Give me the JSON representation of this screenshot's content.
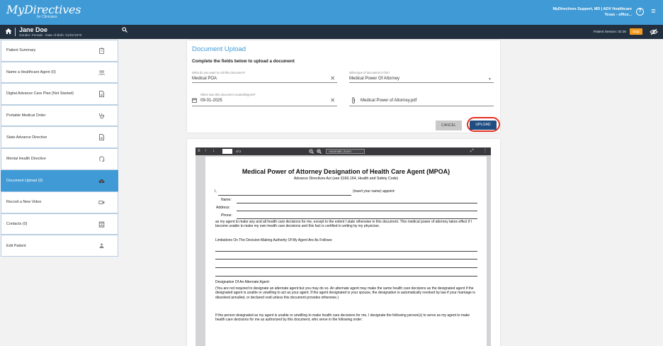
{
  "header": {
    "logo_text": "MyDirectives",
    "logo_sub": "for Clinicians",
    "account_line1": "MyDirectives Support, MD | ADV Healthcare",
    "account_line2": "Texas - office...",
    "brand_color": "#3f9ad6",
    "icons": [
      "help-icon",
      "menu-icon"
    ]
  },
  "patient": {
    "name": "Jane Doe",
    "info": "Gender: Female · Date of Birth: 01/01/1970",
    "session": "Patient Session: 02:35",
    "stop_label": "Stop"
  },
  "sidebar": {
    "items": [
      {
        "label": "Patient Summary",
        "icon": "clipboard-icon"
      },
      {
        "label": "Name a Healthcare Agent (0)",
        "icon": "people-icon"
      },
      {
        "label": "Digital Advance Care Plan (Not Started)",
        "icon": "document-icon"
      },
      {
        "label": "Portable Medical Order",
        "icon": "stethoscope-icon"
      },
      {
        "label": "State Advance Directive",
        "icon": "document-icon"
      },
      {
        "label": "Mental Health Directive",
        "icon": "head-icon"
      },
      {
        "label": "Document Upload (0)",
        "icon": "cloud-upload-icon",
        "active": true
      },
      {
        "label": "Record a New Video",
        "icon": "video-icon"
      },
      {
        "label": "Contacts (0)",
        "icon": "contacts-icon"
      },
      {
        "label": "Edit Patient",
        "icon": "person-icon"
      }
    ]
  },
  "upload": {
    "title": "Document Upload",
    "subtitle": "Complete the fields below to upload a document",
    "name_label": "What do you want to call this document?",
    "name_value": "Medical POA",
    "type_label": "What type of document is this?",
    "type_value": "Medical Power Of Attorney",
    "date_label": "When was this document created/signed?",
    "date_value": "09-01-2025",
    "file_value": "Medical Power of Attorney.pdf",
    "cancel_label": "CANCEL",
    "upload_label": "UPLOAD",
    "highlight_color": "#e2301e"
  },
  "viewer": {
    "zoom_label": "Automatic Zoom",
    "page_of": "of 2",
    "title": "Medical Power of Attorney Designation of Health Care Agent (MPOA)",
    "subtitle": "Advance Directives Act (see §166.164, Health and Safety Code)",
    "line_i": "I,",
    "insert_name": "(insert your name) appoint:",
    "name_label": "Name:",
    "address_label": "Address:",
    "phone_label": "Phone:",
    "para1": "as my agent to make any and all health care decisions for me, except to the extent I state otherwise in this document. This medical power of attorney takes effect if I become unable to make my own health care decisions and this fact is certified in writing by my physician.",
    "limitations": "Limitations On The Decision-Making Authority Of My Agent Are As Follows:",
    "alternate": "Designation Of An Alternate Agent:",
    "para2": "(You are not required to designate an alternate agent but you may do so. An alternate agent may make the same health care decisions as the designated agent if the designated agent is unable or unwilling to act as your agent. If the agent designated is your spouse, the designation is automatically revoked by law if your marriage is dissolved annulled, or declared void unless this document provides otherwise.)",
    "para3": "If the person designated as my agent is unable or unwilling to make health care decisions for me, I designate the following person(s) to serve as my agent to make health care decisions for me as authorized by this document, who serve in the following order:"
  }
}
